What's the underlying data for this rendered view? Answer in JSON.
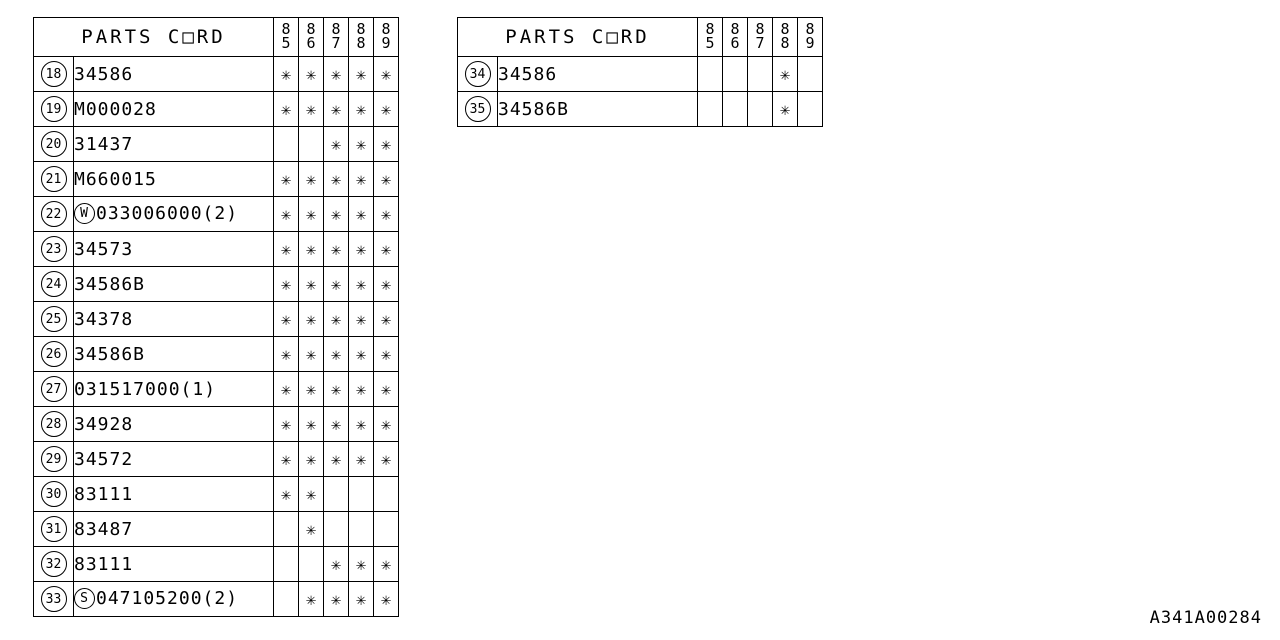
{
  "document": {
    "code": "A341A00284"
  },
  "glyphs": {
    "mark": "✳",
    "circle_w": "W",
    "circle_s": "S"
  },
  "tables": [
    {
      "id": "left",
      "header": {
        "title": "PARTS C□RD",
        "years": [
          "85",
          "86",
          "87",
          "88",
          "89"
        ]
      },
      "rows": [
        {
          "index": "18",
          "prefix": "",
          "name": "34586",
          "marks": [
            true,
            true,
            true,
            true,
            true
          ]
        },
        {
          "index": "19",
          "prefix": "",
          "name": "M000028",
          "marks": [
            true,
            true,
            true,
            true,
            true
          ]
        },
        {
          "index": "20",
          "prefix": "",
          "name": "31437",
          "marks": [
            false,
            false,
            true,
            true,
            true
          ]
        },
        {
          "index": "21",
          "prefix": "",
          "name": "M660015",
          "marks": [
            true,
            true,
            true,
            true,
            true
          ]
        },
        {
          "index": "22",
          "prefix": "W",
          "name": "033006000(2)",
          "marks": [
            true,
            true,
            true,
            true,
            true
          ]
        },
        {
          "index": "23",
          "prefix": "",
          "name": "34573",
          "marks": [
            true,
            true,
            true,
            true,
            true
          ]
        },
        {
          "index": "24",
          "prefix": "",
          "name": "34586B",
          "marks": [
            true,
            true,
            true,
            true,
            true
          ]
        },
        {
          "index": "25",
          "prefix": "",
          "name": "34378",
          "marks": [
            true,
            true,
            true,
            true,
            true
          ]
        },
        {
          "index": "26",
          "prefix": "",
          "name": "34586B",
          "marks": [
            true,
            true,
            true,
            true,
            true
          ]
        },
        {
          "index": "27",
          "prefix": "",
          "name": "031517000(1)",
          "marks": [
            true,
            true,
            true,
            true,
            true
          ]
        },
        {
          "index": "28",
          "prefix": "",
          "name": "34928",
          "marks": [
            true,
            true,
            true,
            true,
            true
          ]
        },
        {
          "index": "29",
          "prefix": "",
          "name": "34572",
          "marks": [
            true,
            true,
            true,
            true,
            true
          ]
        },
        {
          "index": "30",
          "prefix": "",
          "name": "83111",
          "marks": [
            true,
            true,
            false,
            false,
            false
          ]
        },
        {
          "index": "31",
          "prefix": "",
          "name": "83487",
          "marks": [
            false,
            true,
            false,
            false,
            false
          ]
        },
        {
          "index": "32",
          "prefix": "",
          "name": "83111",
          "marks": [
            false,
            false,
            true,
            true,
            true
          ]
        },
        {
          "index": "33",
          "prefix": "S",
          "name": "047105200(2)",
          "marks": [
            false,
            true,
            true,
            true,
            true
          ]
        }
      ]
    },
    {
      "id": "right",
      "header": {
        "title": "PARTS C□RD",
        "years": [
          "85",
          "86",
          "87",
          "88",
          "89"
        ]
      },
      "rows": [
        {
          "index": "34",
          "prefix": "",
          "name": "34586",
          "marks": [
            false,
            false,
            false,
            true,
            false
          ]
        },
        {
          "index": "35",
          "prefix": "",
          "name": "34586B",
          "marks": [
            false,
            false,
            false,
            true,
            false
          ]
        }
      ]
    }
  ]
}
